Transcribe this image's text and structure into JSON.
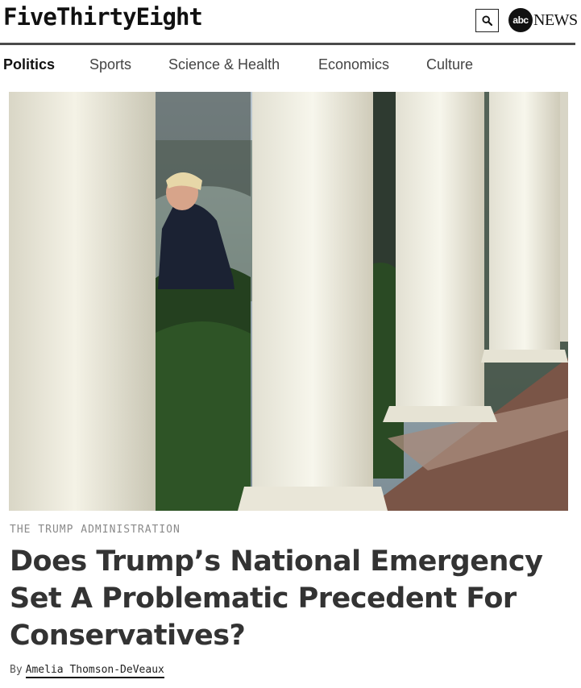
{
  "header": {
    "logo_text": "FiveThirtyEight",
    "search_icon": "search-icon",
    "partner_logo_mark": "abc",
    "partner_logo_text": "NEWS"
  },
  "nav": {
    "items": [
      {
        "label": "Politics",
        "active": true
      },
      {
        "label": "Sports",
        "active": false
      },
      {
        "label": "Science & Health",
        "active": false
      },
      {
        "label": "Economics",
        "active": false
      },
      {
        "label": "Culture",
        "active": false
      }
    ]
  },
  "article": {
    "kicker": "THE TRUMP ADMINISTRATION",
    "headline": "Does Trump’s National Emergency Set A Problematic Precedent For Conservatives?",
    "byline_prefix": "By",
    "author": "Amelia Thomson-DeVeaux"
  },
  "colors": {
    "rule": "#4a4a4a",
    "headline": "#333333",
    "kicker": "#8a8a8a"
  }
}
